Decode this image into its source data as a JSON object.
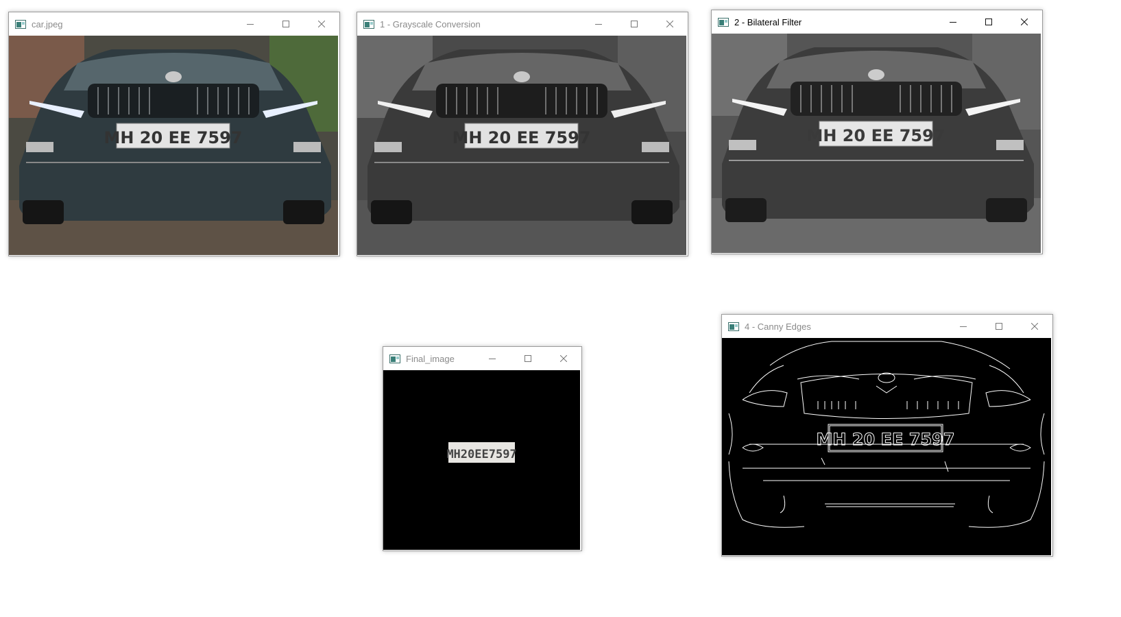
{
  "windows": [
    {
      "title": "car.jpeg"
    },
    {
      "title": "1 - Grayscale Conversion"
    },
    {
      "title": "2 - Bilateral Filter"
    },
    {
      "title": "Final_image"
    },
    {
      "title": "4 - Canny Edges"
    }
  ],
  "plate_text": "MH 20 EE 7597",
  "plate_text_final": "MH20EE7597",
  "icons": {
    "app": "opencv-window-icon",
    "minimize": "minimize-icon",
    "maximize": "maximize-icon",
    "close": "close-icon"
  },
  "colors": {
    "car_body": "#2f3b40",
    "gray_body": "#3a3a3a",
    "plate_bg": "#e4e4e4",
    "edge_line": "#ffffff"
  }
}
